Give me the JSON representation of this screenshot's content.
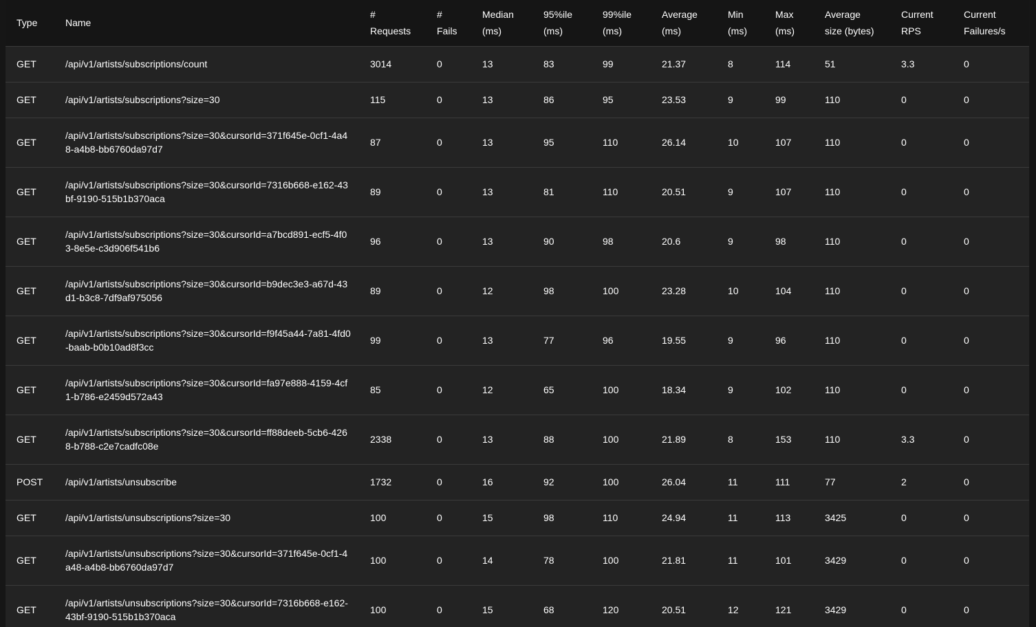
{
  "columns": [
    {
      "l1": "Type",
      "l2": ""
    },
    {
      "l1": "Name",
      "l2": ""
    },
    {
      "l1": "#",
      "l2": "Requests"
    },
    {
      "l1": "#",
      "l2": "Fails"
    },
    {
      "l1": "Median",
      "l2": "(ms)"
    },
    {
      "l1": "95%ile",
      "l2": "(ms)"
    },
    {
      "l1": "99%ile",
      "l2": "(ms)"
    },
    {
      "l1": "Average",
      "l2": "(ms)"
    },
    {
      "l1": "Min",
      "l2": "(ms)"
    },
    {
      "l1": "Max",
      "l2": "(ms)"
    },
    {
      "l1": "Average",
      "l2": "size (bytes)"
    },
    {
      "l1": "Current",
      "l2": "RPS"
    },
    {
      "l1": "Current",
      "l2": "Failures/s"
    }
  ],
  "rows": [
    {
      "type": "GET",
      "name": "/api/v1/artists/subscriptions/count",
      "requests": "3014",
      "fails": "0",
      "median": "13",
      "p95": "83",
      "p99": "99",
      "avg": "21.37",
      "min": "8",
      "max": "114",
      "size": "51",
      "rps": "3.3",
      "fps": "0"
    },
    {
      "type": "GET",
      "name": "/api/v1/artists/subscriptions?size=30",
      "requests": "115",
      "fails": "0",
      "median": "13",
      "p95": "86",
      "p99": "95",
      "avg": "23.53",
      "min": "9",
      "max": "99",
      "size": "110",
      "rps": "0",
      "fps": "0"
    },
    {
      "type": "GET",
      "name": "/api/v1/artists/subscriptions?size=30&cursorId=371f645e-0cf1-4a48-a4b8-bb6760da97d7",
      "requests": "87",
      "fails": "0",
      "median": "13",
      "p95": "95",
      "p99": "110",
      "avg": "26.14",
      "min": "10",
      "max": "107",
      "size": "110",
      "rps": "0",
      "fps": "0"
    },
    {
      "type": "GET",
      "name": "/api/v1/artists/subscriptions?size=30&cursorId=7316b668-e162-43bf-9190-515b1b370aca",
      "requests": "89",
      "fails": "0",
      "median": "13",
      "p95": "81",
      "p99": "110",
      "avg": "20.51",
      "min": "9",
      "max": "107",
      "size": "110",
      "rps": "0",
      "fps": "0"
    },
    {
      "type": "GET",
      "name": "/api/v1/artists/subscriptions?size=30&cursorId=a7bcd891-ecf5-4f03-8e5e-c3d906f541b6",
      "requests": "96",
      "fails": "0",
      "median": "13",
      "p95": "90",
      "p99": "98",
      "avg": "20.6",
      "min": "9",
      "max": "98",
      "size": "110",
      "rps": "0",
      "fps": "0"
    },
    {
      "type": "GET",
      "name": "/api/v1/artists/subscriptions?size=30&cursorId=b9dec3e3-a67d-43d1-b3c8-7df9af975056",
      "requests": "89",
      "fails": "0",
      "median": "12",
      "p95": "98",
      "p99": "100",
      "avg": "23.28",
      "min": "10",
      "max": "104",
      "size": "110",
      "rps": "0",
      "fps": "0"
    },
    {
      "type": "GET",
      "name": "/api/v1/artists/subscriptions?size=30&cursorId=f9f45a44-7a81-4fd0-baab-b0b10ad8f3cc",
      "requests": "99",
      "fails": "0",
      "median": "13",
      "p95": "77",
      "p99": "96",
      "avg": "19.55",
      "min": "9",
      "max": "96",
      "size": "110",
      "rps": "0",
      "fps": "0"
    },
    {
      "type": "GET",
      "name": "/api/v1/artists/subscriptions?size=30&cursorId=fa97e888-4159-4cf1-b786-e2459d572a43",
      "requests": "85",
      "fails": "0",
      "median": "12",
      "p95": "65",
      "p99": "100",
      "avg": "18.34",
      "min": "9",
      "max": "102",
      "size": "110",
      "rps": "0",
      "fps": "0"
    },
    {
      "type": "GET",
      "name": "/api/v1/artists/subscriptions?size=30&cursorId=ff88deeb-5cb6-4268-b788-c2e7cadfc08e",
      "requests": "2338",
      "fails": "0",
      "median": "13",
      "p95": "88",
      "p99": "100",
      "avg": "21.89",
      "min": "8",
      "max": "153",
      "size": "110",
      "rps": "3.3",
      "fps": "0"
    },
    {
      "type": "POST",
      "name": "/api/v1/artists/unsubscribe",
      "requests": "1732",
      "fails": "0",
      "median": "16",
      "p95": "92",
      "p99": "100",
      "avg": "26.04",
      "min": "11",
      "max": "111",
      "size": "77",
      "rps": "2",
      "fps": "0"
    },
    {
      "type": "GET",
      "name": "/api/v1/artists/unsubscriptions?size=30",
      "requests": "100",
      "fails": "0",
      "median": "15",
      "p95": "98",
      "p99": "110",
      "avg": "24.94",
      "min": "11",
      "max": "113",
      "size": "3425",
      "rps": "0",
      "fps": "0"
    },
    {
      "type": "GET",
      "name": "/api/v1/artists/unsubscriptions?size=30&cursorId=371f645e-0cf1-4a48-a4b8-bb6760da97d7",
      "requests": "100",
      "fails": "0",
      "median": "14",
      "p95": "78",
      "p99": "100",
      "avg": "21.81",
      "min": "11",
      "max": "101",
      "size": "3429",
      "rps": "0",
      "fps": "0"
    },
    {
      "type": "GET",
      "name": "/api/v1/artists/unsubscriptions?size=30&cursorId=7316b668-e162-43bf-9190-515b1b370aca",
      "requests": "100",
      "fails": "0",
      "median": "15",
      "p95": "68",
      "p99": "120",
      "avg": "20.51",
      "min": "12",
      "max": "121",
      "size": "3429",
      "rps": "0",
      "fps": "0"
    }
  ]
}
